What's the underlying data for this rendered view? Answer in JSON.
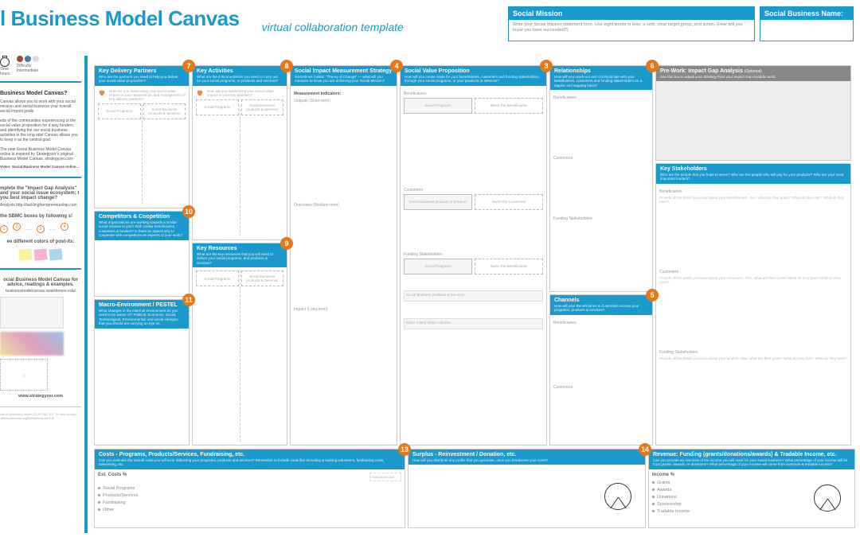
{
  "header": {
    "title": "l Business Model Canvas",
    "subtitle": "virtual collaboration template"
  },
  "topFields": {
    "mission": {
      "label": "Social Mission",
      "hint": "Write your Social Mission statement here. Use eight words or less; a verb, clear target group, and action.\n(How will you know you have succeeded?)"
    },
    "name": {
      "label": "Social Business Name:"
    }
  },
  "sidebar": {
    "meta": {
      "timeLabel": "Time",
      "time": "hours",
      "diffLabel": "Difficulty",
      "diff": "Intermediate"
    },
    "s1h": "Business Model Canvas?",
    "s1t": "Canvas allows you to work with your social mission and social business your overall social impact goals.\n\neds of the communities experiencing ut the social value proposition for d way funders, and identifying the our social business activities in the long odel Canvas allows you to keep n as the central goal.",
    "s1n": "The new Social Business Model Canvas online is inspired by Strategyzer's original Business Model Canvas. strategyzer.com",
    "s1link": "Video: Social Business Model Canvas online…",
    "s2a": "mplete the \"Impact Gap Analysis\" and your social issue ecosystem; t you best impact change?",
    "s2alink": "Analysis http://tacklingheropreneurship.com",
    "s2b": "the SBMC boxes by following s!",
    "s2c": "ee different colors of post-its:",
    "s3h": "ocial Business Model Canvas for advice, readings & examples.",
    "s3link": "businessmodelcanvas.swarthmore.edu/",
    "s3site": "www.strategyzer.com",
    "license": "vas is (licensed) under CC-BY-NC 4.0. To view a copy :ativecommons.org/licenses/by-nc/4.0/"
  },
  "blocks": {
    "kdp": {
      "n": "7",
      "t": "Key Delivery Partners",
      "s": "Who are the partners you need to help you deliver your social value proposition?",
      "q": "How are you maximizing your social value impact in your relationships and management of key delivery partners?",
      "c1": "Social Programs",
      "c2": "Social Business products & Services"
    },
    "comp": {
      "n": "10",
      "t": "Competitors & Coopetition",
      "s": "What organizations are working towards a similar social mission to you? With similar beneficiaries, customers & funders? Is there an opportunity to cooperate with competitors on aspects of your work?"
    },
    "macro": {
      "n": "11",
      "t": "Macro-Environment / PESTEL",
      "s": "What changes in the external environment do you need to be aware of? Political, Economic, Social, Technological, Environmental, and social changes that you should are carrying an eye on."
    },
    "ka": {
      "n": "8",
      "t": "Key Activities",
      "s": "What are the critical activities you need to carry out for your social programs, or products and services?",
      "q": "How are you maximizing your social value impact in your key activities?",
      "c1": "Social Programs",
      "c2": "Social Business products & Services"
    },
    "kr": {
      "n": "9",
      "t": "Key Resources",
      "s": "What are the key resources that you will need to deliver your social programs, and products & services?",
      "c1": "Social Programs",
      "c2": "Social Business products & Services"
    },
    "sim": {
      "n": "4",
      "t": "Social Impact Measurement Strategy",
      "s": "Sometimes Called: \"Theory of Change\" — what will you measure to know you are achieving your Social Mission?",
      "l1": "Measurement Indicators:",
      "l1s": "Outputs (Short-term)",
      "l2": "Outcomes (Medium-term)",
      "l3": "Impact (Long-term)"
    },
    "svp": {
      "n": "3",
      "t": "Social Value Proposition",
      "s": "How will you create value for your beneficiaries, customers and funding stakeholders, through your social programs, or your products or services?",
      "ben": "Beneficiaries",
      "benC1": "Social Programs",
      "benC2": "Name the Beneficiaries",
      "cust": "Customers",
      "custC1": "Social Business products & Services",
      "custC2": "Name the Customers",
      "fund": "Funding Stakeholders",
      "fundC1": "Social Programs",
      "fundC2": "Name the Beneficiaries",
      "sbps": "Social Business products & Services",
      "other": "Other Added Value Activities"
    },
    "rel": {
      "n": "6",
      "t": "Relationships",
      "s": "How will you reach out and communicate with your beneficiaries, customers and funding stakeholders on a regular and ongoing basis?",
      "l1": "Beneficiaries",
      "l2": "Customers",
      "l3": "Funding Stakeholders"
    },
    "chan": {
      "n": "5",
      "t": "Channels",
      "s": "How will your Beneficiaries & Customers receive your programs, products & services?",
      "l1": "Beneficiaries",
      "l2": "Customers"
    },
    "prework": {
      "t": "Pre-Work: Impact Gap Analysis",
      "opt": "(Optional)",
      "s": "Use this box to adjust your Strategy from your Impact Gap Analysis work."
    },
    "stake": {
      "t": "Key Stakeholders",
      "s": "Who are the people that you hope to serve? Who are the people who will pay for your products? Who are your most important funders?",
      "l1": "Beneficiaries",
      "l1s": "Provide all the detail you know about your beneficiaries. Also, what are their goals? What do they fear? What do they need?",
      "l2": "Customers",
      "l2s": "Provide all the detail you know about your customers. Also, what are their goals? What do they fear? What do they need?",
      "l3": "Funding Stakeholders",
      "l3s": "Provide all the detail you know about your funders. Also, what are their goals? What do they fear? What do they need?"
    }
  },
  "bottom": {
    "costs": {
      "n": "13",
      "t": "Costs - Programs, Products/Services, Fundraising, etc.",
      "s": "Can you estimate the overall costs you will incur delivering your programs, products and services? Remember to include costs like recruiting & training volunteers, fundraising costs, networking, etc.",
      "h": "Est. Costs %",
      "tip": "How much total",
      "items": [
        "Social Programs",
        "Products/Services",
        "Fundraising",
        "Other"
      ]
    },
    "surplus": {
      "n": "14",
      "t": "Surplus - Reinvestment / Donation, etc.",
      "s": "How will you distribute any profits that you generate, once you breakeven your costs?"
    },
    "revenue": {
      "t": "Revenue: Funding (grants/donations/awards) & Tradable Income, etc.",
      "s": "Can you provide an overview of the income you will need for your social business? What percentage of your income will be from grants, awards, or donations? What percentage of your income will come from contracts & tradable income?",
      "h": "Income %",
      "items": [
        "Grants",
        "Awards",
        "Donations",
        "Sponsorship",
        "Tradable Income"
      ]
    }
  }
}
